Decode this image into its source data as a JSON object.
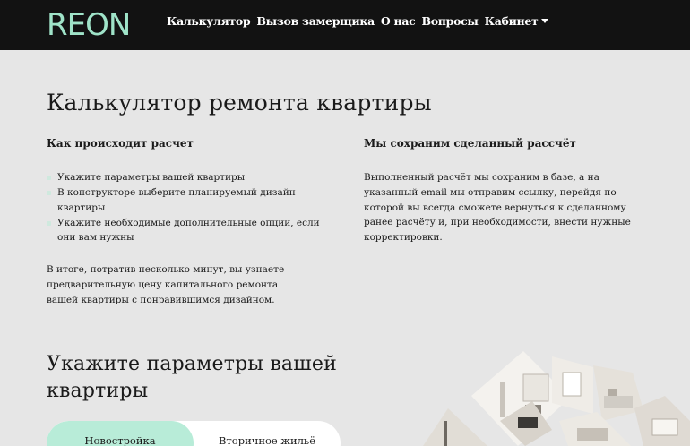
{
  "app": {
    "logo": "REON",
    "accent_color": "#9fe3c8",
    "nav": [
      {
        "label": "Калькулятор"
      },
      {
        "label": "Вызов замерщика"
      },
      {
        "label": "О нас"
      },
      {
        "label": "Вопросы"
      },
      {
        "label": "Кабинет",
        "has_dropdown": true
      }
    ]
  },
  "page": {
    "title": "Калькулятор ремонта квартиры",
    "how": {
      "heading": "Как происходит расчет",
      "steps": [
        "Укажите параметры вашей квартиры",
        "В конструкторе выберите планируемый дизайн квартиры",
        "Укажите необходимые дополнительные опции, если они вам нужны"
      ],
      "summary": "В итоге, потратив несколько минут, вы узнаете предварительную цену капитального ремонта вашей квартиры с понравившимся дизайном."
    },
    "save": {
      "heading": "Мы сохраним сделанный рассчёт",
      "text": "Выполненный расчёт мы сохраним в базе, а на указанный email мы отправим ссылку, перейдя по которой вы всегда сможете вернуться к сделанному ранее расчёту и, при необходимости, внести нужные корректировки."
    },
    "params": {
      "title": "Укажите параметры вашей квартиры",
      "tabs": [
        {
          "label": "Новостройка",
          "active": true
        },
        {
          "label": "Вторичное жильё",
          "active": false
        }
      ]
    }
  }
}
